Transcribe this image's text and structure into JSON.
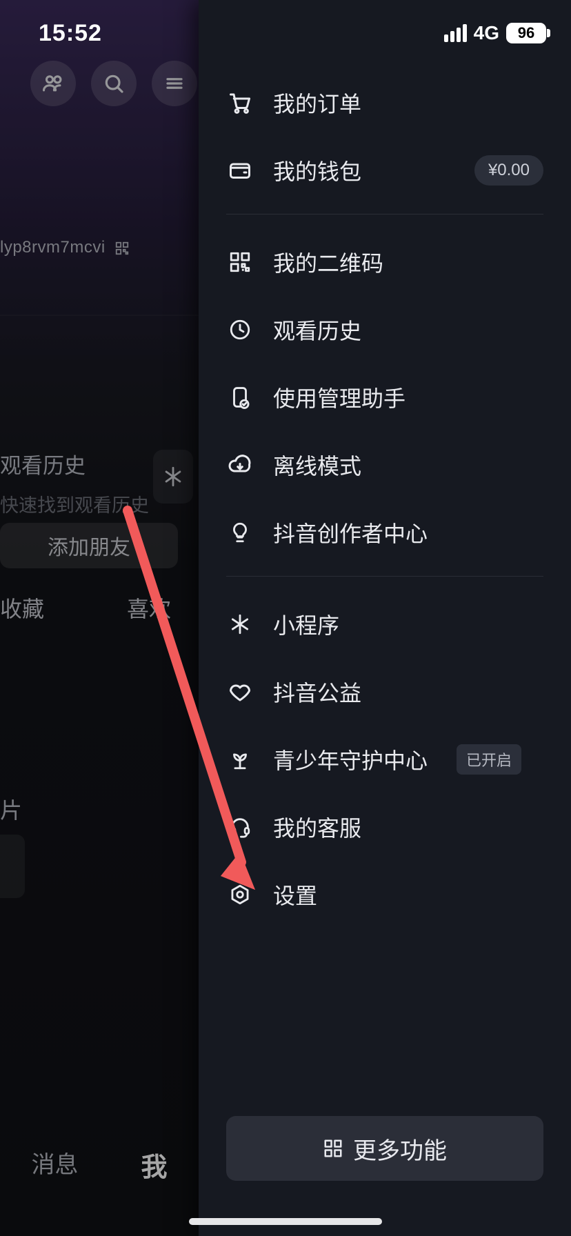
{
  "status": {
    "time": "15:52",
    "network": "4G",
    "battery": "96"
  },
  "background": {
    "uid": "lyp8rvm7mcvi",
    "watch_title": "观看历史",
    "watch_sub": "快速找到观看历史",
    "add_friend": "添加朋友",
    "tab_collect": "收藏",
    "tab_like": "喜欢",
    "label_piece": "片",
    "bottom_msg": "消息",
    "bottom_me": "我"
  },
  "drawer": {
    "items": [
      {
        "icon": "cart-icon",
        "label": "我的订单"
      },
      {
        "icon": "wallet-icon",
        "label": "我的钱包",
        "money": "¥0.00"
      }
    ],
    "items2": [
      {
        "icon": "qr-icon",
        "label": "我的二维码"
      },
      {
        "icon": "clock-icon",
        "label": "观看历史"
      },
      {
        "icon": "phone-check-icon",
        "label": "使用管理助手"
      },
      {
        "icon": "cloud-down-icon",
        "label": "离线模式"
      },
      {
        "icon": "bulb-icon",
        "label": "抖音创作者中心"
      }
    ],
    "items3": [
      {
        "icon": "spark-icon",
        "label": "小程序"
      },
      {
        "icon": "heart-icon",
        "label": "抖音公益"
      },
      {
        "icon": "sprout-icon",
        "label": "青少年守护中心",
        "state": "已开启"
      },
      {
        "icon": "headset-icon",
        "label": "我的客服"
      },
      {
        "icon": "gear-icon",
        "label": "设置"
      }
    ],
    "more": "更多功能"
  }
}
